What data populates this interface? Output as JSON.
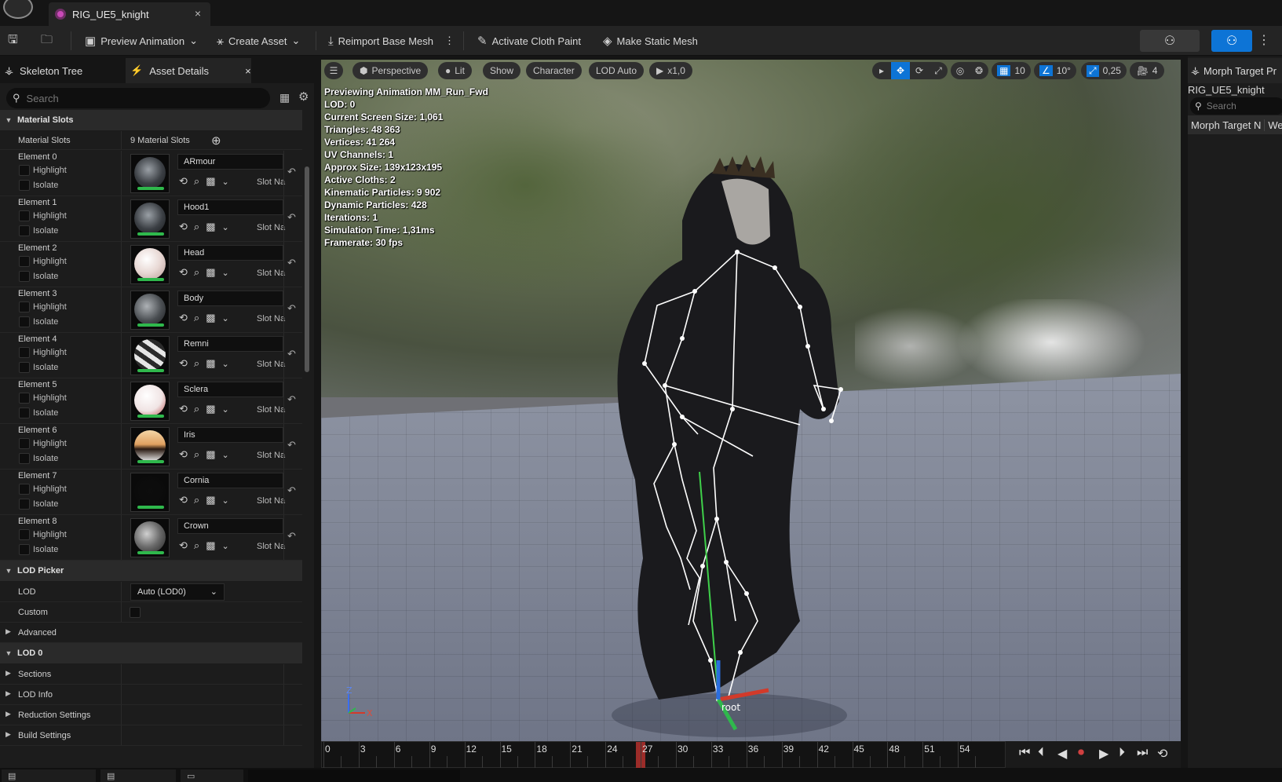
{
  "window": {
    "tab_title": "RIG_UE5_knight",
    "tab_close": "×"
  },
  "toolbar": {
    "save_icon": "save-icon",
    "browse_icon": "browse-icon",
    "preview_animation": "Preview Animation",
    "create_asset": "Create Asset",
    "reimport_base_mesh": "Reimport Base Mesh",
    "activate_cloth_paint": "Activate Cloth Paint",
    "make_static_mesh": "Make Static Mesh"
  },
  "left_panel": {
    "tab_skeleton_tree": "Skeleton Tree",
    "tab_asset_details": "Asset Details",
    "tab_close": "×",
    "search_placeholder": "Search",
    "material_slots_category": "Material Slots",
    "material_slots_label": "Material Slots",
    "material_slots_count": "9 Material Slots",
    "highlight_label": "Highlight",
    "isolate_label": "Isolate",
    "slot_name_label": "Slot Na",
    "elements": [
      {
        "label": "Element 0",
        "material": "ARmour",
        "thumb": "armor"
      },
      {
        "label": "Element 1",
        "material": "Hood1",
        "thumb": "armor"
      },
      {
        "label": "Element 2",
        "material": "Head",
        "thumb": "skin"
      },
      {
        "label": "Element 3",
        "material": "Body",
        "thumb": "body"
      },
      {
        "label": "Element 4",
        "material": "Remni",
        "thumb": "stripes"
      },
      {
        "label": "Element 5",
        "material": "Sclera",
        "thumb": "sclera"
      },
      {
        "label": "Element 6",
        "material": "Iris",
        "thumb": "iris"
      },
      {
        "label": "Element 7",
        "material": "Cornia",
        "thumb": "cornia"
      },
      {
        "label": "Element 8",
        "material": "Crown",
        "thumb": "crown"
      }
    ],
    "lod_picker_category": "LOD Picker",
    "lod_label": "LOD",
    "lod_value": "Auto (LOD0)",
    "custom_label": "Custom",
    "advanced_label": "Advanced",
    "lod0_category": "LOD 0",
    "sections_label": "Sections",
    "lod_info_label": "LOD Info",
    "reduction_settings_label": "Reduction Settings",
    "build_settings_label": "Build Settings"
  },
  "viewport": {
    "perspective": "Perspective",
    "lit": "Lit",
    "show": "Show",
    "character": "Character",
    "lod_auto": "LOD Auto",
    "play_speed": "x1,0",
    "grid_size": "10",
    "rotation_snap": "10°",
    "scale_snap": "0,25",
    "camera_speed": "4",
    "stats": [
      "Previewing Animation MM_Run_Fwd",
      "LOD: 0",
      "Current Screen Size: 1,061",
      "Triangles: 48 363",
      "Vertices: 41 264",
      "UV Channels: 1",
      "Approx Size: 139x123x195",
      "Active Cloths: 2",
      "Kinematic Particles: 9 902",
      "Dynamic Particles: 428",
      "Iterations: 1",
      "Simulation Time: 1,31ms",
      "Framerate: 30 fps"
    ],
    "root_bone_label": "root",
    "axis_z": "Z",
    "axis_x": "X"
  },
  "timeline": {
    "frames": [
      "0",
      "3",
      "6",
      "9",
      "12",
      "15",
      "18",
      "21",
      "24",
      "27",
      "30",
      "33",
      "36",
      "39",
      "42",
      "45",
      "48",
      "51",
      "54"
    ],
    "current_frame": "27"
  },
  "right_panel": {
    "tab_title": "Morph Target Pr",
    "asset_name": "RIG_UE5_knight",
    "search_placeholder": "Search",
    "col_morph_target": "Morph Target N",
    "col_weight": "We"
  },
  "colors": {
    "accent_blue": "#0d74d6",
    "highlight_green": "#2fb84c",
    "timeline_cursor": "#b4312e"
  }
}
